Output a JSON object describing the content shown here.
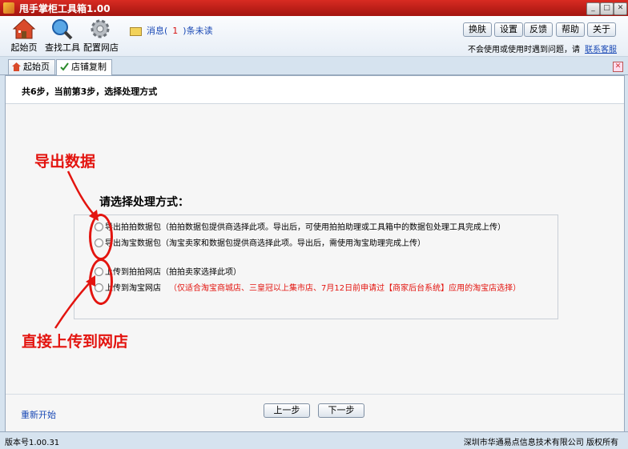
{
  "window": {
    "title": "甩手掌柜工具箱1.00"
  },
  "toolbar": {
    "items": [
      {
        "label": "起始页",
        "icon": "home-icon"
      },
      {
        "label": "查找工具",
        "icon": "magnifier-icon"
      },
      {
        "label": "配置网店",
        "icon": "gear-icon"
      }
    ],
    "message_prefix": "消息(",
    "message_count": "1",
    "message_suffix": ")条未读",
    "buttons": [
      "换肤",
      "设置",
      "反馈",
      "帮助",
      "关于"
    ],
    "help_text": "不会使用或使用时遇到问题，请",
    "help_link": "联系客服"
  },
  "tabs": [
    {
      "label": "起始页",
      "icon": "home-icon"
    },
    {
      "label": "店铺复制",
      "icon": "check-icon",
      "active": true
    }
  ],
  "wizard": {
    "step_text": "共6步，当前第3步，选择处理方式",
    "choose_title": "请选择处理方式：",
    "options": [
      {
        "label": "导出拍拍数据包（拍拍数据包提供商选择此项。导出后，可使用拍拍助理或工具箱中的数据包处理工具完成上传）",
        "note": "",
        "selected": false
      },
      {
        "label": "导出淘宝数据包（淘宝卖家和数据包提供商选择此项。导出后，需使用淘宝助理完成上传）",
        "note": "",
        "selected": false
      },
      {
        "label": "上传到拍拍网店（拍拍卖家选择此项）",
        "note": "",
        "selected": false
      },
      {
        "label": "上传到淘宝网店",
        "note": "（仅适合淘宝商城店、三皇冠以上集市店、7月12日前申请过【商家后台系统】应用的淘宝店选择）",
        "selected": false
      }
    ],
    "annotations": {
      "export": "导出数据",
      "upload": "直接上传到网店"
    },
    "restart": "重新开始",
    "prev": "上一步",
    "next": "下一步"
  },
  "status": {
    "version": "版本号1.00.31",
    "copyright": "深圳市华通易点信息技术有限公司 版权所有"
  },
  "colors": {
    "title_bar": "#c01f18",
    "annotation_red": "#e3140f",
    "link_blue": "#1a49b5"
  }
}
